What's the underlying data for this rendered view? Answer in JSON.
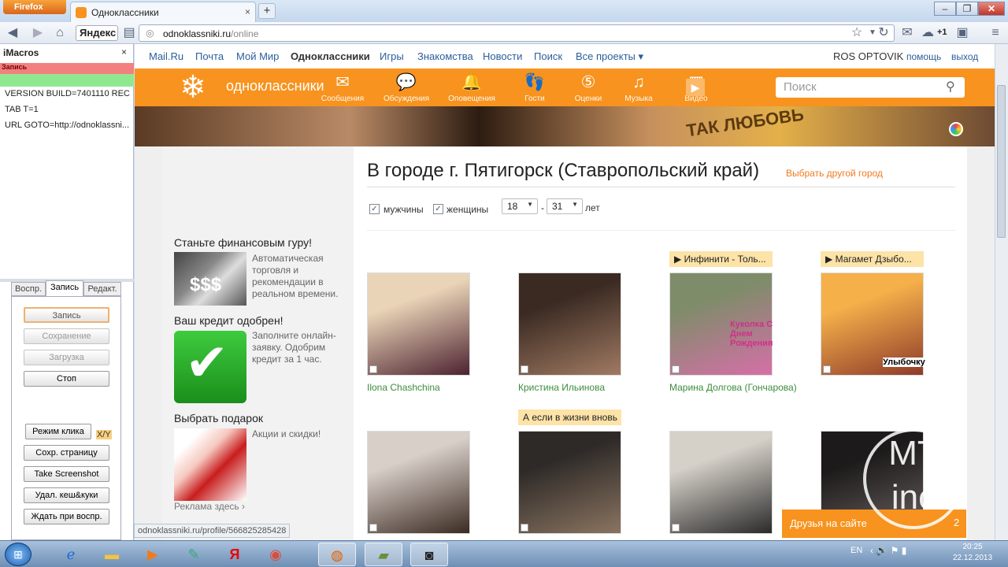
{
  "browser": {
    "menu_button": "Firefox",
    "tab_title": "Одноклассники",
    "new_tab": "+",
    "tab_close": "×",
    "yandex_button": "Яндекс",
    "url_domain": "odnoklassniki.ru",
    "url_path": "/online",
    "toolbar_count": "+1",
    "window_min": "–",
    "window_max": "❐",
    "window_close": "✕"
  },
  "imacros": {
    "title": "iMacros",
    "close": "×",
    "record_label": "Запись",
    "lines": [
      "VERSION BUILD=7401110 REC...",
      "TAB T=1",
      "URL GOTO=http://odnoklassni..."
    ],
    "tabs": [
      "Воспр.",
      "Запись",
      "Редакт."
    ],
    "buttons": {
      "record": "Запись",
      "save": "Сохранение",
      "load": "Загрузка",
      "stop": "Стоп",
      "click_mode": "Режим клика",
      "save_page": "Сохр. страницу",
      "screenshot": "Take Screenshot",
      "clear_cache": "Удал. кеш&куки",
      "wait": "Ждать при воспр."
    },
    "xy": "X/Y"
  },
  "status_url": "odnoklassniki.ru/profile/566825285428",
  "site": {
    "top_menu": [
      "Mail.Ru",
      "Почта",
      "Мой Мир",
      "Одноклассники",
      "Игры",
      "Знакомства",
      "Новости",
      "Поиск",
      "Все проекты ▾"
    ],
    "user_name": "ROS OPTOVIK",
    "help": "помощь",
    "logout": "выход",
    "logo_text": "одноклассники",
    "nav": [
      {
        "label": "Сообщения",
        "icon": "envelope-icon",
        "glyph": "✉"
      },
      {
        "label": "Обсуждения",
        "icon": "chat-bubbles-icon",
        "glyph": "💬"
      },
      {
        "label": "Оповещения",
        "icon": "bell-icon",
        "glyph": "🔔"
      },
      {
        "label": "Гости",
        "icon": "footprints-icon",
        "glyph": "👣"
      },
      {
        "label": "Оценки",
        "icon": "rating-5-icon",
        "glyph": "⑤"
      },
      {
        "label": "Музыка",
        "icon": "music-note-icon",
        "glyph": "♫"
      },
      {
        "label": "Видео",
        "icon": "film-icon",
        "glyph": "▦"
      }
    ],
    "search_placeholder": "Поиск",
    "banner_text": "ТАК ЛЮБОВЬ",
    "ads": [
      {
        "title": "Станьте финансовым гуру!",
        "text": "Автоматическая торговля и рекомендации в реальном времени."
      },
      {
        "title": "Ваш кредит одобрен!",
        "text": "Заполните онлайн-заявку. Одобрим кредит за 1 час."
      },
      {
        "title": "Выбрать подарок",
        "text": "Акции и скидки!"
      }
    ],
    "ad_link": "Реклама здесь ›",
    "heading": "В городе г. Пятигорск (Ставропольский край)",
    "change_city": "Выбрать другой город",
    "filter_men": "мужчины",
    "filter_women": "женщины",
    "age_from": "18",
    "age_to": "31",
    "age_dash": "-",
    "age_unit": "лет",
    "people": [
      {
        "name": "Ilona Chashchina",
        "tag": "",
        "photo_colors": [
          "#e9d4b7",
          "#4c2230"
        ]
      },
      {
        "name": "Кристина Ильинова",
        "tag": "",
        "photo_colors": [
          "#3a2a22",
          "#a07a62"
        ]
      },
      {
        "name": "Марина Долгова (Гончарова)",
        "tag": "▶ Инфинити - Толь...",
        "photo_colors": [
          "#7f8c6a",
          "#d66fa8"
        ]
      },
      {
        "name": "",
        "tag": "▶ Магамет Дзыбо...",
        "photo_colors": [
          "#f6b04a",
          "#8e3b2a"
        ]
      },
      {
        "name": "",
        "tag": "",
        "photo_colors": [
          "#d8cfc9",
          "#3b2a22"
        ]
      },
      {
        "name": "",
        "tag": "А если в жизни вновь",
        "photo_colors": [
          "#2e2a28",
          "#8a7460"
        ]
      },
      {
        "name": "",
        "tag": "",
        "photo_colors": [
          "#d5d0c8",
          "#2a2a2a"
        ]
      },
      {
        "name": "",
        "tag": "",
        "photo_colors": [
          "#1c1a1a",
          "#6a6060"
        ]
      }
    ],
    "sticker_text_1": "Куколка С Днем Рождения",
    "sticker_text_2": "Улыбочку",
    "friends_online": "Друзья на сайте",
    "friends_count": "2",
    "watermark": "MT inc"
  },
  "taskbar": {
    "lang": "EN",
    "time": "20:25",
    "date": "22.12.2013"
  }
}
